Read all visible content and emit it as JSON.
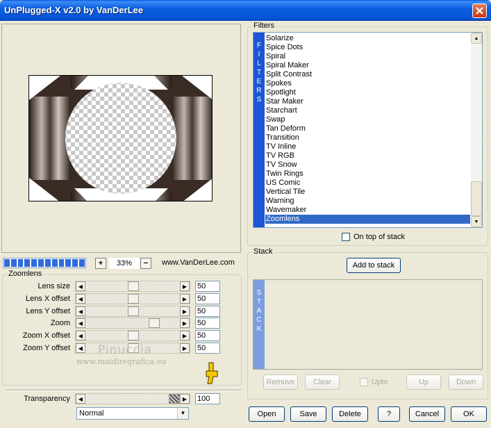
{
  "window": {
    "title": "UnPlugged-X v2.0 by VanDerLee"
  },
  "zoom": {
    "value": "33%",
    "plus_label": "+",
    "minus_label": "−",
    "website": "www.VanDerLee.com"
  },
  "zoomlens": {
    "group_label": "Zoomlens",
    "params": [
      {
        "label": "Lens size",
        "value": "50",
        "level": 0.5
      },
      {
        "label": "Lens X offset",
        "value": "50",
        "level": 0.5
      },
      {
        "label": "Lens Y offset",
        "value": "50",
        "level": 0.5
      },
      {
        "label": "Zoom",
        "value": "50",
        "level": 0.7
      },
      {
        "label": "Zoom X offset",
        "value": "50",
        "level": 0.5
      },
      {
        "label": "Zoom Y offset",
        "value": "50",
        "level": 0.5
      }
    ],
    "transparency_label": "Transparency",
    "transparency_value": "100",
    "transparency_level": 1.0,
    "blend_mode": "Normal"
  },
  "filters": {
    "group_label": "Filters",
    "side_label": [
      "F",
      "I",
      "L",
      "T",
      "E",
      "R",
      "S"
    ],
    "items": [
      "Solarize",
      "Spice Dots",
      "Spiral",
      "Spiral Maker",
      "Split Contrast",
      "Spokes",
      "Spotlight",
      "Star Maker",
      "Starchart",
      "Swap",
      "Tan Deform",
      "Transition",
      "TV Inline",
      "TV RGB",
      "TV Snow",
      "Twin Rings",
      "US Comic",
      "Vertical Tile",
      "Warning",
      "Wavemaker",
      "Zoomlens"
    ],
    "selected": "Zoomlens",
    "on_top_label": "On top of stack"
  },
  "stack": {
    "group_label": "Stack",
    "add_label": "Add to stack",
    "side_label": [
      "S",
      "T",
      "A",
      "C",
      "K"
    ],
    "remove_label": "Remove",
    "clear_label": "Clear",
    "upto_label": "Upto",
    "up_label": "Up",
    "down_label": "Down"
  },
  "bottom_buttons": {
    "open": "Open",
    "save": "Save",
    "delete": "Delete",
    "help": "?",
    "cancel": "Cancel",
    "ok": "OK"
  },
  "watermark": {
    "name": "Pinuccia",
    "url": "www.maidiregrafica.eu"
  },
  "colors": {
    "title_bar": "#0554d8",
    "filters_bar": "#1c56d6",
    "selection": "#316ac5",
    "stack_bar": "#7c9ee0",
    "progress": "#2f6bdc"
  }
}
